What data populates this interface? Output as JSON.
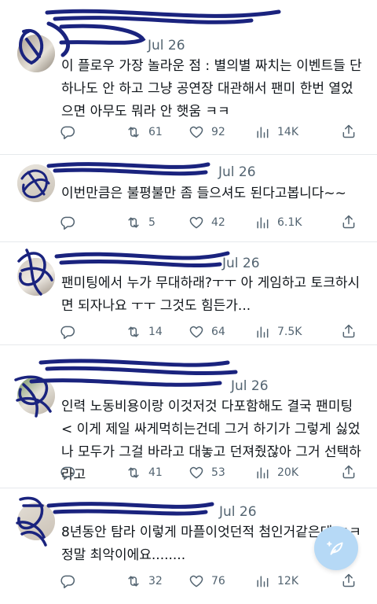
{
  "tweets": [
    {
      "date": "Jul 26",
      "text": "이 플로우 가장 놀라운 점 : 별의별 짜치는 이벤트들 단 하나도 안 하고 그냥 공연장 대관해서 팬미 한번 열었으면 아무도 뭐라 안 햇움 ㅋㅋ",
      "replies": "",
      "reposts": "61",
      "likes": "92",
      "views": "14K"
    },
    {
      "date": "Jul 26",
      "text": "이번만큼은 불평불만 좀 들으셔도 된다고봅니다~~",
      "replies": "",
      "reposts": "5",
      "likes": "42",
      "views": "6.1K"
    },
    {
      "date": "Jul 26",
      "text": "팬미팅에서 누가 무대하래?ㅜㅜ 아 게임하고 토크하시면 되자나요 ㅜㅜ 그것도 힘든가...",
      "replies": "",
      "reposts": "14",
      "likes": "64",
      "views": "7.5K"
    },
    {
      "date": "Jul 26",
      "text": "인력 노동비용이랑 이것저것 다포함해도 결국 팬미팅 < 이게 제일 싸게먹히는건데 그거 하기가 그렇게 싫었나 모두가 그걸 바라고 대놓고 던져줬잖아 그거 선택하라고",
      "replies": "",
      "reposts": "41",
      "likes": "53",
      "views": "20K"
    },
    {
      "date": "Jul 26",
      "text": "8년동안 탐라 이렇게 마플이엇던적 첨인거같은데 ㅋㅋ 정말 최악이에요........",
      "replies": "",
      "reposts": "32",
      "likes": "76",
      "views": "12K"
    }
  ],
  "icons": {
    "reply": "reply-icon",
    "repost": "repost-icon",
    "like": "heart-icon",
    "views": "views-icon",
    "share": "share-icon",
    "compose": "compose-icon"
  },
  "colors": {
    "muted": "#536471",
    "text": "#0f1419",
    "fab": "#b6d9f6",
    "scribble": "#1a237e"
  }
}
